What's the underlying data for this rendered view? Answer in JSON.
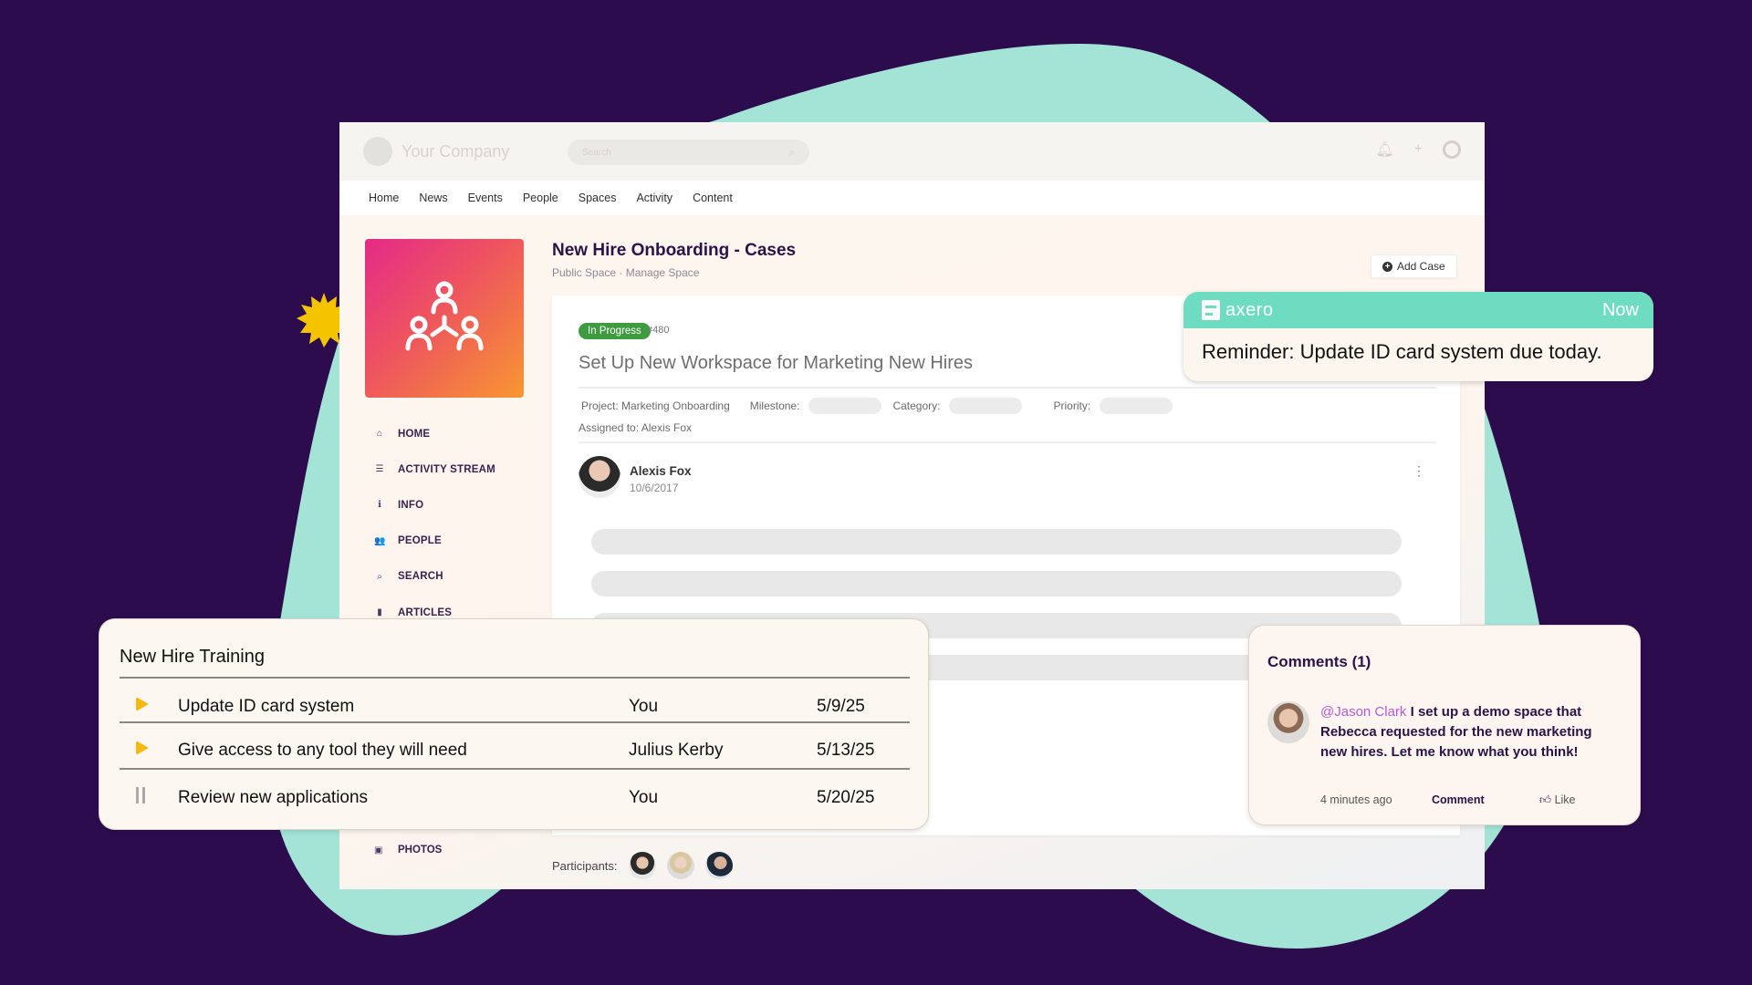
{
  "colors": {
    "background": "#2d0c4e",
    "blob": "#a3e4d7",
    "accent_teal": "#6ddcc1",
    "status_green": "#3f9b3f",
    "title_purple": "#2a1347",
    "mention": "#b45ad8",
    "star": "#f5c400"
  },
  "header": {
    "company": "Your Company",
    "search_placeholder": "Search",
    "icons": [
      "bell-icon",
      "plus-icon",
      "user-circle-icon"
    ]
  },
  "nav": {
    "items": [
      "Home",
      "News",
      "Events",
      "People",
      "Spaces",
      "Activity",
      "Content"
    ]
  },
  "sidebar": {
    "tile_icon": "people-network-icon",
    "items": [
      {
        "label": "HOME",
        "icon": "home-icon",
        "glyph": "⌂"
      },
      {
        "label": "ACTIVITY STREAM",
        "icon": "list-icon",
        "glyph": "☰"
      },
      {
        "label": "INFO",
        "icon": "info-icon",
        "glyph": "ℹ"
      },
      {
        "label": "PEOPLE",
        "icon": "people-icon",
        "glyph": "👥"
      },
      {
        "label": "SEARCH",
        "icon": "search-icon",
        "glyph": "⌕"
      },
      {
        "label": "ARTICLES",
        "icon": "document-icon",
        "glyph": "▮"
      }
    ],
    "photos": {
      "label": "PHOTOS",
      "icon": "image-icon",
      "glyph": "▣"
    }
  },
  "page": {
    "title": "New Hire Onboarding - Cases",
    "subtitle": "Public Space  ·  Manage Space",
    "add_case": "Add Case"
  },
  "case": {
    "status": "In Progress",
    "number": "#480",
    "title": "Set Up New Workspace for Marketing New Hires",
    "project": "Project: Marketing Onboarding",
    "milestone_label": "Milestone:",
    "category_label": "Category:",
    "priority_label": "Priority:",
    "assigned": "Assigned to: Alexis Fox",
    "author": "Alexis Fox",
    "date": "10/6/2017"
  },
  "participants": {
    "label": "Participants:"
  },
  "toast": {
    "brand": "axero",
    "time": "Now",
    "message": "Reminder: Update ID card system due today."
  },
  "training": {
    "title": "New Hire Training",
    "rows": [
      {
        "status": "play",
        "task": "Update ID card system",
        "assignee": "You",
        "date": "5/9/25"
      },
      {
        "status": "play",
        "task": "Give access to any tool they will need",
        "assignee": "Julius Kerby",
        "date": "5/13/25"
      },
      {
        "status": "pause",
        "task": "Review new applications",
        "assignee": "You",
        "date": "5/20/25"
      }
    ]
  },
  "comments": {
    "title": "Comments (1)",
    "mention": "@Jason Clark",
    "text": " I set up a demo space that Rebecca requested for the new marketing new hires. Let me know what you think!",
    "time": "4 minutes ago",
    "comment_label": "Comment",
    "like_label": "Like"
  }
}
